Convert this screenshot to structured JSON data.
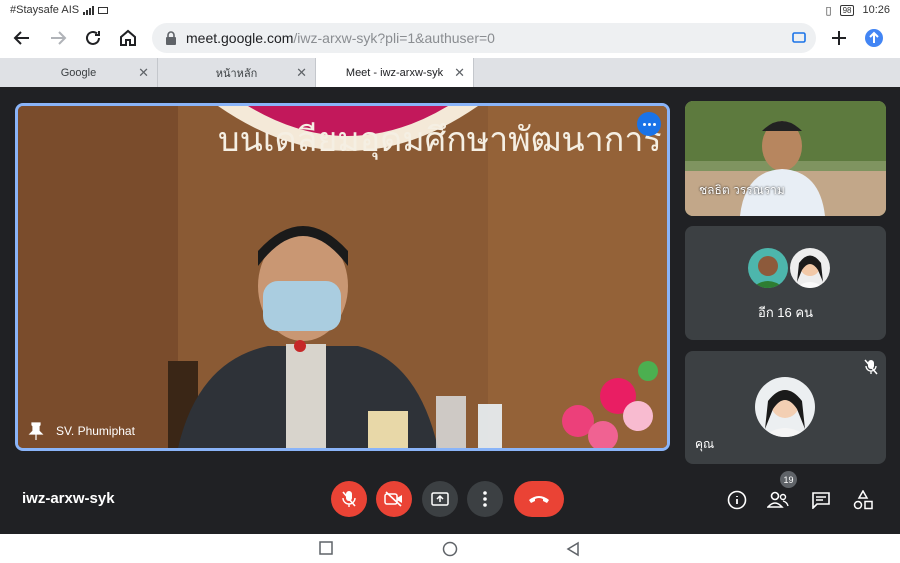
{
  "status": {
    "carrier": "#Staysafe AIS",
    "battery": "98",
    "time": "10:26"
  },
  "browser": {
    "url_domain": "meet.google.com",
    "url_path": "/iwz-arxw-syk?pli=1&authuser=0",
    "tabs": [
      {
        "label": "Google"
      },
      {
        "label": "หน้าหลัก"
      },
      {
        "label": "Meet - iwz-arxw-syk"
      }
    ]
  },
  "meet": {
    "main_speaker": "SV. Phumiphat",
    "banner_text": "บนเดลียมอุดมศึกษาพัฒนาการ อุด",
    "tile1_name": "ชลธิต วรรณราม",
    "others_label": "อีก 16 คน",
    "self_label": "คุณ",
    "meeting_code": "iwz-arxw-syk",
    "participants_count": "19"
  },
  "colors": {
    "accent": "#8ab4f8",
    "danger": "#ea4335",
    "bg": "#202124"
  }
}
